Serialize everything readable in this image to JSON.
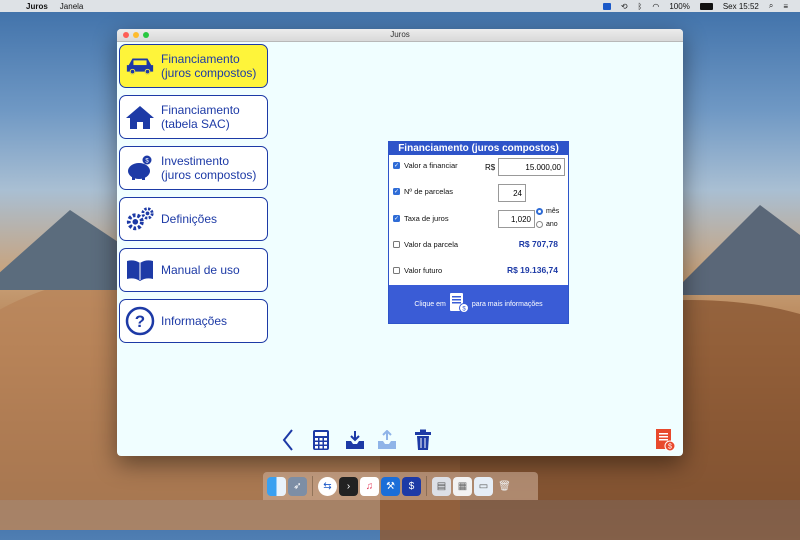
{
  "menubar": {
    "app_name": "Juros",
    "menu_window": "Janela",
    "battery": "100%",
    "clock": "Sex 15:52"
  },
  "window": {
    "title": "Juros"
  },
  "sidebar": {
    "items": [
      {
        "line1": "Financiamento",
        "line2": "(juros compostos)",
        "icon": "car-icon",
        "active": true
      },
      {
        "line1": "Financiamento",
        "line2": "(tabela SAC)",
        "icon": "house-icon",
        "active": false
      },
      {
        "line1": "Investimento",
        "line2": "(juros compostos)",
        "icon": "piggy-bank-icon",
        "active": false
      },
      {
        "line1": "Definições",
        "line2": "",
        "icon": "gears-icon",
        "active": false
      },
      {
        "line1": "Manual de uso",
        "line2": "",
        "icon": "book-icon",
        "active": false
      },
      {
        "line1": "Informações",
        "line2": "",
        "icon": "question-icon",
        "active": false
      }
    ]
  },
  "panel": {
    "title": "Financiamento (juros compostos)",
    "rows": {
      "valor_financiar": {
        "label": "Valor a financiar",
        "prefix": "R$",
        "value": "15.000,00",
        "checked": true
      },
      "parcelas": {
        "label": "Nº de parcelas",
        "value": "24",
        "checked": true
      },
      "taxa": {
        "label": "Taxa de juros",
        "value": "1,020",
        "checked": true,
        "period_month": "mês",
        "period_year": "ano",
        "selected": "mês"
      },
      "valor_parcela": {
        "label": "Valor da parcela",
        "value": "R$ 707,78",
        "checked": false
      },
      "valor_futuro": {
        "label": "Valor futuro",
        "value": "R$ 19.136,74",
        "checked": false
      }
    },
    "footer": {
      "before": "Clique em",
      "after": "para mais informações"
    }
  },
  "colors": {
    "accent_blue": "#1d3aa6",
    "panel_blue": "#2e54c9",
    "active_yellow": "#fef43a",
    "window_bg": "#f0feff"
  }
}
